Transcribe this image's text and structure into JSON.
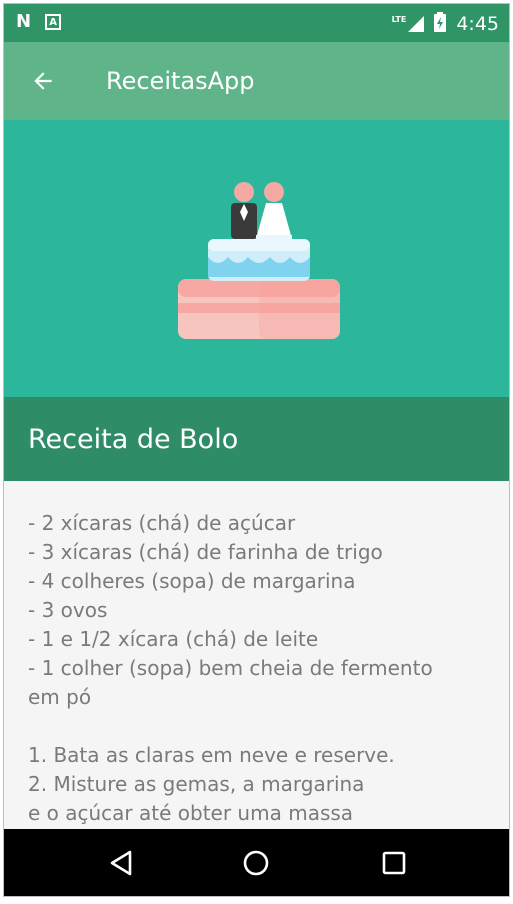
{
  "status_bar": {
    "left_icons": [
      "n-notification-icon",
      "a-notification-icon"
    ],
    "network_label": "LTE",
    "time": "4:45"
  },
  "app_bar": {
    "title": "ReceitasApp",
    "back_icon": "arrow-back-icon"
  },
  "hero": {
    "image": "wedding-cake-icon",
    "background_color": "#2cb79c"
  },
  "recipe": {
    "title": "Receita de Bolo",
    "lines": [
      "- 2 xícaras (chá) de açúcar",
      "- 3 xícaras (chá) de farinha de trigo",
      "- 4 colheres (sopa) de margarina",
      "- 3 ovos",
      "- 1 e 1/2 xícara (chá) de leite",
      "- 1 colher (sopa) bem cheia de fermento",
      "em pó",
      "",
      "1. Bata as claras em neve e reserve.",
      "2. Misture as gemas, a margarina",
      "e o açúcar até obter uma massa"
    ]
  },
  "nav_bar": {
    "buttons": [
      "back-triangle-icon",
      "home-circle-icon",
      "recents-square-icon"
    ]
  },
  "colors": {
    "status_bar": "#2f9466",
    "app_bar": "#60b48a",
    "title_bar": "#2e8c66",
    "body_text": "#7a7a7a"
  }
}
